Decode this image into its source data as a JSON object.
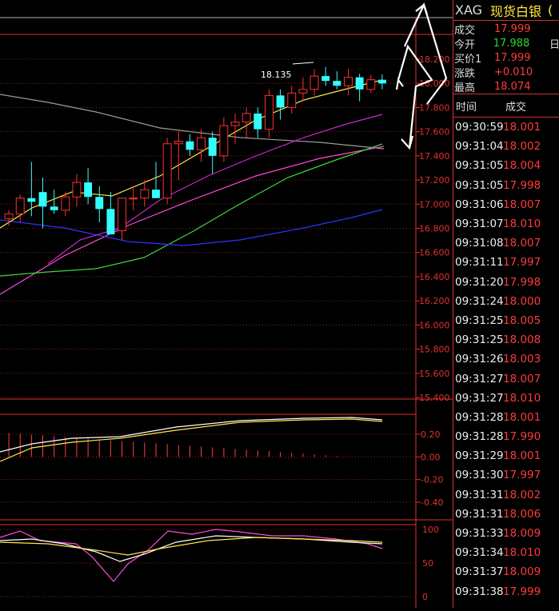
{
  "header": {
    "symbol": "XAG",
    "name": "现货白银",
    "extra": "("
  },
  "quote": [
    {
      "label": "成交",
      "value": "17.999",
      "color": "red",
      "ext": ""
    },
    {
      "label": "今开",
      "value": "17.988",
      "color": "green",
      "ext": "日"
    },
    {
      "label": "买价1",
      "value": "17.999",
      "color": "red",
      "ext": ""
    },
    {
      "label": "涨跌",
      "value": "+0.010",
      "color": "red",
      "ext": ""
    },
    {
      "label": "最高",
      "value": "18.074",
      "color": "red",
      "ext": ""
    }
  ],
  "ticks_table": {
    "headers": [
      "时间",
      "成交"
    ],
    "rows": [
      [
        "09:30:59",
        "18.001"
      ],
      [
        "09:31:04",
        "18.002"
      ],
      [
        "09:31:05",
        "18.004"
      ],
      [
        "09:31:05",
        "17.998"
      ],
      [
        "09:31:06",
        "18.007"
      ],
      [
        "09:31:07",
        "18.010"
      ],
      [
        "09:31:08",
        "18.007"
      ],
      [
        "09:31:11",
        "17.997"
      ],
      [
        "09:31:20",
        "17.998"
      ],
      [
        "09:31:24",
        "18.000"
      ],
      [
        "09:31:25",
        "18.005"
      ],
      [
        "09:31:25",
        "18.008"
      ],
      [
        "09:31:26",
        "18.003"
      ],
      [
        "09:31:27",
        "18.007"
      ],
      [
        "09:31:27",
        "18.010"
      ],
      [
        "09:31:28",
        "18.001"
      ],
      [
        "09:31:28",
        "17.990"
      ],
      [
        "09:31:29",
        "18.001"
      ],
      [
        "09:31:30",
        "17.997"
      ],
      [
        "09:31:31",
        "18.002"
      ],
      [
        "09:31:31",
        "18.006"
      ],
      [
        "09:31:33",
        "18.009"
      ],
      [
        "09:31:34",
        "18.010"
      ],
      [
        "09:31:37",
        "18.009"
      ],
      [
        "09:31:38",
        "17.999"
      ]
    ]
  },
  "chart_data": [
    {
      "type": "candlestick",
      "price_axis_ticks": [
        "18.200",
        "18.000",
        "17.800",
        "17.600",
        "17.400",
        "17.200",
        "17.000",
        "16.800",
        "16.600",
        "16.400",
        "16.200",
        "16.000",
        "15.800",
        "15.600",
        "15.400"
      ],
      "ylim": [
        15.4,
        18.2
      ],
      "annotations": [
        "18.135"
      ],
      "candles": [
        {
          "o": 16.88,
          "h": 16.95,
          "l": 16.82,
          "c": 16.92
        },
        {
          "o": 16.92,
          "h": 17.08,
          "l": 16.85,
          "c": 17.05
        },
        {
          "o": 17.05,
          "h": 17.35,
          "l": 16.9,
          "c": 17.02
        },
        {
          "o": 17.1,
          "h": 17.22,
          "l": 16.8,
          "c": 16.98
        },
        {
          "o": 16.98,
          "h": 17.12,
          "l": 16.92,
          "c": 16.95
        },
        {
          "o": 16.95,
          "h": 17.1,
          "l": 16.9,
          "c": 17.06
        },
        {
          "o": 17.06,
          "h": 17.25,
          "l": 16.98,
          "c": 17.18
        },
        {
          "o": 17.18,
          "h": 17.3,
          "l": 17.0,
          "c": 17.06
        },
        {
          "o": 17.06,
          "h": 17.15,
          "l": 16.85,
          "c": 16.96
        },
        {
          "o": 16.96,
          "h": 17.1,
          "l": 16.78,
          "c": 16.75
        },
        {
          "o": 16.78,
          "h": 17.0,
          "l": 16.7,
          "c": 17.05
        },
        {
          "o": 17.05,
          "h": 17.15,
          "l": 16.95,
          "c": 17.05
        },
        {
          "o": 17.05,
          "h": 17.2,
          "l": 16.98,
          "c": 17.12
        },
        {
          "o": 17.12,
          "h": 17.35,
          "l": 17.05,
          "c": 17.05
        },
        {
          "o": 17.05,
          "h": 17.55,
          "l": 17.0,
          "c": 17.5
        },
        {
          "o": 17.5,
          "h": 17.6,
          "l": 17.2,
          "c": 17.52
        },
        {
          "o": 17.52,
          "h": 17.58,
          "l": 17.4,
          "c": 17.45
        },
        {
          "o": 17.45,
          "h": 17.62,
          "l": 17.35,
          "c": 17.55
        },
        {
          "o": 17.55,
          "h": 17.6,
          "l": 17.25,
          "c": 17.4
        },
        {
          "o": 17.4,
          "h": 17.72,
          "l": 17.35,
          "c": 17.65
        },
        {
          "o": 17.65,
          "h": 17.75,
          "l": 17.5,
          "c": 17.68
        },
        {
          "o": 17.68,
          "h": 17.8,
          "l": 17.55,
          "c": 17.75
        },
        {
          "o": 17.75,
          "h": 17.8,
          "l": 17.55,
          "c": 17.62
        },
        {
          "o": 17.62,
          "h": 17.95,
          "l": 17.55,
          "c": 17.9
        },
        {
          "o": 17.9,
          "h": 17.95,
          "l": 17.7,
          "c": 17.8
        },
        {
          "o": 17.8,
          "h": 17.98,
          "l": 17.75,
          "c": 17.92
        },
        {
          "o": 17.92,
          "h": 18.05,
          "l": 17.85,
          "c": 17.95
        },
        {
          "o": 17.95,
          "h": 18.12,
          "l": 17.9,
          "c": 18.06
        },
        {
          "o": 18.06,
          "h": 18.135,
          "l": 17.98,
          "c": 18.02
        },
        {
          "o": 18.02,
          "h": 18.1,
          "l": 17.95,
          "c": 17.98
        },
        {
          "o": 17.98,
          "h": 18.12,
          "l": 17.9,
          "c": 18.05
        },
        {
          "o": 18.05,
          "h": 18.08,
          "l": 17.85,
          "c": 17.95
        },
        {
          "o": 17.95,
          "h": 18.07,
          "l": 17.92,
          "c": 18.03
        },
        {
          "o": 18.03,
          "h": 18.074,
          "l": 17.95,
          "c": 17.999
        }
      ]
    },
    {
      "type": "bar",
      "macd_axis_ticks": [
        "0.20",
        "0.00",
        "-0.20",
        "-0.40"
      ],
      "ylim": [
        -0.4,
        0.2
      ]
    },
    {
      "type": "line",
      "kdj_axis_ticks": [
        "100",
        "50",
        "0"
      ],
      "ylim": [
        0,
        100
      ]
    }
  ]
}
